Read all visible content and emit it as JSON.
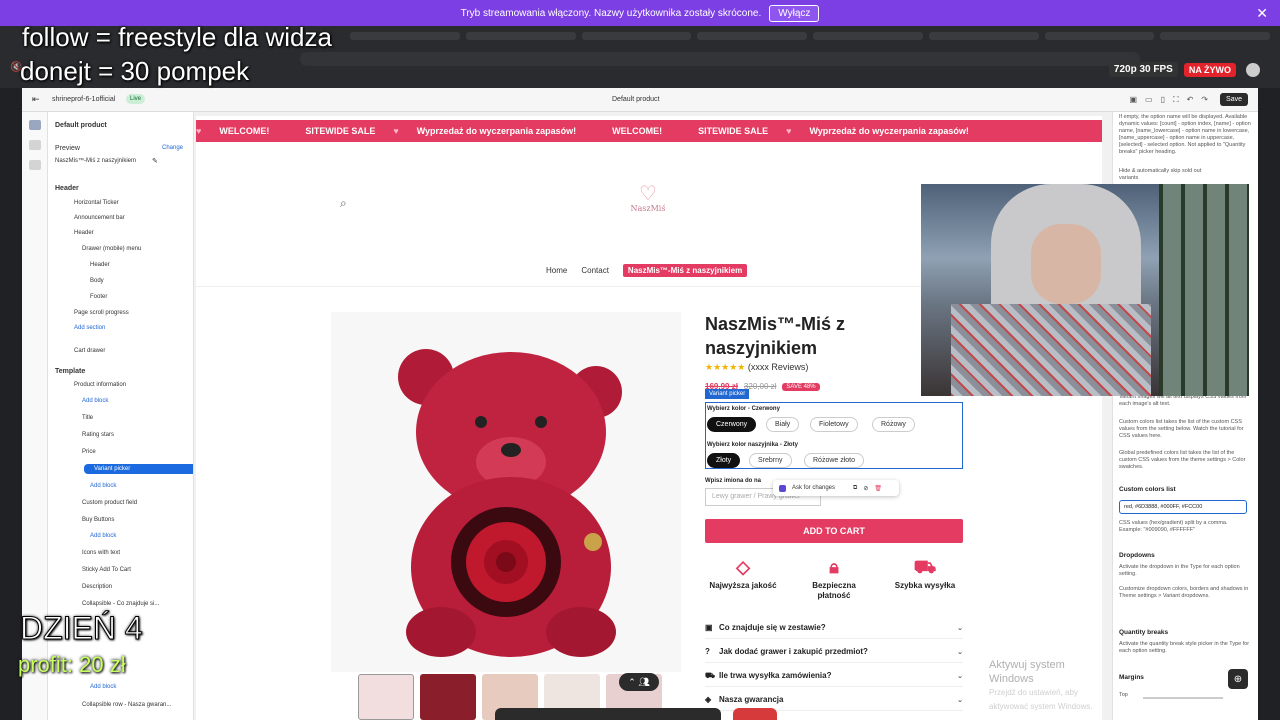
{
  "banner": {
    "text": "Tryb streamowania włączony. Nazwy użytkownika zostały skrócone.",
    "button": "Wyłącz"
  },
  "stream": {
    "quality": "720p 30 FPS",
    "live": "NA ŻYWO"
  },
  "overlay": {
    "line1": "follow = freestyle dla widza",
    "line2": "donejt = 30 pompek",
    "day": "DZIEŃ 4",
    "profit": "profit: 20 zł"
  },
  "editor": {
    "store": "shrineprof-6-1official",
    "status": "Live",
    "template": "Default product",
    "save": "Save"
  },
  "left_panel": {
    "title": "Default product",
    "preview_label": "Preview",
    "change_link": "Change",
    "preview_value": "NaszMis™-Miś z naszyjnikiem",
    "header_section": "Header",
    "items_header": [
      "Horizontal Ticker",
      "Announcement bar",
      "Header",
      "Drawer (mobile) menu",
      "Header",
      "Body",
      "Footer",
      "Page scroll progress"
    ],
    "add_section": "Add section",
    "cart_drawer": "Cart drawer",
    "template_section": "Template",
    "product_info": "Product information",
    "add_block": "Add block",
    "blocks": [
      "Title",
      "Rating stars",
      "Price"
    ],
    "variant_picker": "Variant picker",
    "blocks2": [
      "Custom product field",
      "Buy Buttons"
    ],
    "blocks3": [
      "Icons with text",
      "Sticky Add To Cart",
      "Description",
      "Collapsible - Co znajduje si..."
    ],
    "collapsible_row": "Collapsible row - Nasza gwaran..."
  },
  "ticker": [
    "WELCOME!",
    "SITEWIDE SALE",
    "Wyprzedaż do wyczerpania zapasów!",
    "WELCOME!",
    "SITEWIDE SALE",
    "Wyprzedaż do wyczerpania zapasów!"
  ],
  "store": {
    "logo": "NaszMiś",
    "nav": [
      "Home",
      "Contact",
      "NaszMis™-Miś z naszyjnikiem"
    ],
    "title": "NaszMis™-Miś z naszyjnikiem",
    "reviews": "(xxxx Reviews)",
    "price_now": "169,99 zł",
    "price_old": "320,00 zł",
    "save_badge": "SAVE 48%",
    "variant_tag": "Variant picker",
    "color_label": "Wybierz kolor - Czerwony",
    "colors": [
      "Czerwony",
      "Biały",
      "Fioletowy",
      "Różowy"
    ],
    "necklace_label": "Wybierz kolor naszyjnika - Złoty",
    "necklaces": [
      "Złoty",
      "Srebrny",
      "Różowe złoto"
    ],
    "engrave_label": "Wpisz imiona do na",
    "engrave_placeholder": "Lewy grawer / Prawy grawer",
    "ask_changes": "Ask for changes",
    "add_to_cart": "ADD TO CART",
    "features": [
      "Najwyższa jakość",
      "Bezpieczna płatność",
      "Szybka wysyłka"
    ],
    "accordion": [
      "Co znajduje się w zestawie?",
      "Jak dodać grawer i zakupić przedmiot?",
      "Ile trwa wysyłka zamówienia?",
      "Nasza gwarancja"
    ]
  },
  "windows": {
    "line1": "Aktywuj system Windows",
    "line2": "Przejdź do ustawień, aby aktywować system Windows."
  },
  "right_panel": {
    "top_text": "If empty, the option name will be displayed. Available dynamic values: [count] - option index, [name] - option name, [name_lowercase] - option name in lowercase, [name_uppercase] - option name in uppercase, [selected] - selected option. Not applied to \"Quantity breaks\" picker heading.",
    "hide_label": "Hide & automatically skip sold out variants",
    "variant_images": "Variant images will alt text displays CSS values from each image's alt text.",
    "custom_colors": "Custom colors list takes the list of the custom CSS values from the setting below. Watch the tutorial for CSS values here.",
    "global_colors": "Global predefined colors list takes the list of the custom CSS values from the theme settings > Color swatches.",
    "colors_list_label": "Custom colors list",
    "colors_list_value": "red, #6D3888, #000FF, #FCC00",
    "css_note": "CSS values (hex/gradient) split by a comma. Example: \"#009090, #FFFFFF\"",
    "dropdowns": "Dropdowns",
    "dropdowns_text": "Activate the dropdown in the Type for each option setting.",
    "dropdowns_text2": "Customize dropdown colors, borders and shadows in Theme settings > Variant dropdowns.",
    "qty_breaks": "Quantity breaks",
    "qty_text": "Activate the quantity break style picker in the Type for each option setting.",
    "margins": "Margins",
    "top_label": "Top"
  }
}
